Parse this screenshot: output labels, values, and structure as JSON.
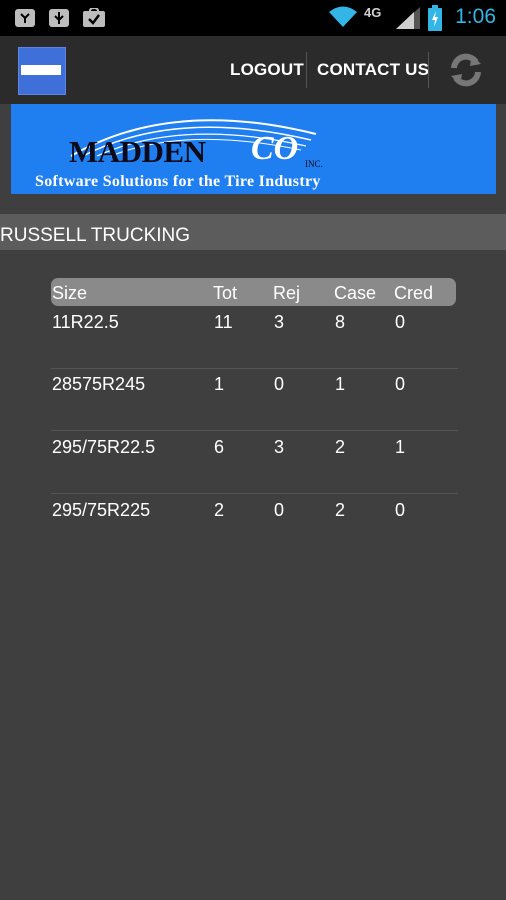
{
  "status_bar": {
    "time": "1:06",
    "network": "4G",
    "icons": [
      "android-debug-icon",
      "usb-icon",
      "shopping-bag-icon",
      "wifi-icon",
      "signal-icon",
      "battery-charging-icon"
    ]
  },
  "action_bar": {
    "logout_label": "LOGOUT",
    "contact_label": "CONTACT US",
    "refresh_icon": "refresh-icon"
  },
  "banner": {
    "brand_main": "MADDEN",
    "brand_co": "CO",
    "inc": "INC.",
    "tagline": "Software Solutions for the Tire Industry"
  },
  "customer": {
    "name": "RUSSELL TRUCKING"
  },
  "table": {
    "headers": [
      "Size",
      "Tot",
      "Rej",
      "Case",
      "Cred"
    ],
    "rows": [
      [
        "11R22.5",
        "11",
        "3",
        "8",
        "0"
      ],
      [
        "28575R245",
        "1",
        "0",
        "1",
        "0"
      ],
      [
        "295/75R22.5",
        "6",
        "3",
        "2",
        "1"
      ],
      [
        "295/75R225",
        "2",
        "0",
        "2",
        "0"
      ]
    ]
  },
  "colors": {
    "background": "#3f3f3f",
    "action_bar": "#2b2b2b",
    "banner": "#1f7ef0",
    "customer_bar": "#5c5c5c",
    "table_header": "#8a8a8a",
    "time": "#33b5e5"
  }
}
